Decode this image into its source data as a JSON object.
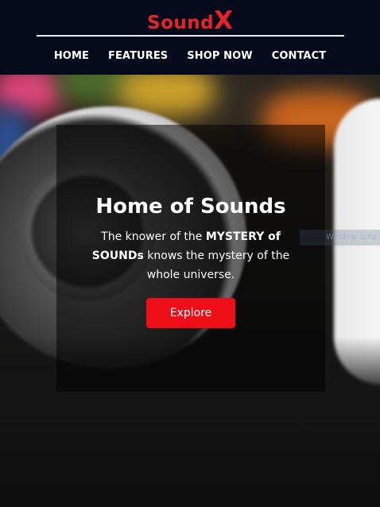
{
  "brand": {
    "logo_word": "Sound",
    "logo_x": "X",
    "accent_color": "#e8222b"
  },
  "nav": {
    "items": [
      {
        "label": "HOME"
      },
      {
        "label": "FEATURES"
      },
      {
        "label": "SHOP NOW"
      },
      {
        "label": "CONTACT"
      }
    ]
  },
  "hero": {
    "title": "Home of Sounds",
    "text_part1": "The knower of the ",
    "text_bold": "MYSTERY of SOUNDs",
    "text_part2": " knows the mystery of the whole universe.",
    "button_label": "Explore",
    "button_color": "#ee0e18"
  },
  "overlay": {
    "snip_label": "Window Snip"
  }
}
